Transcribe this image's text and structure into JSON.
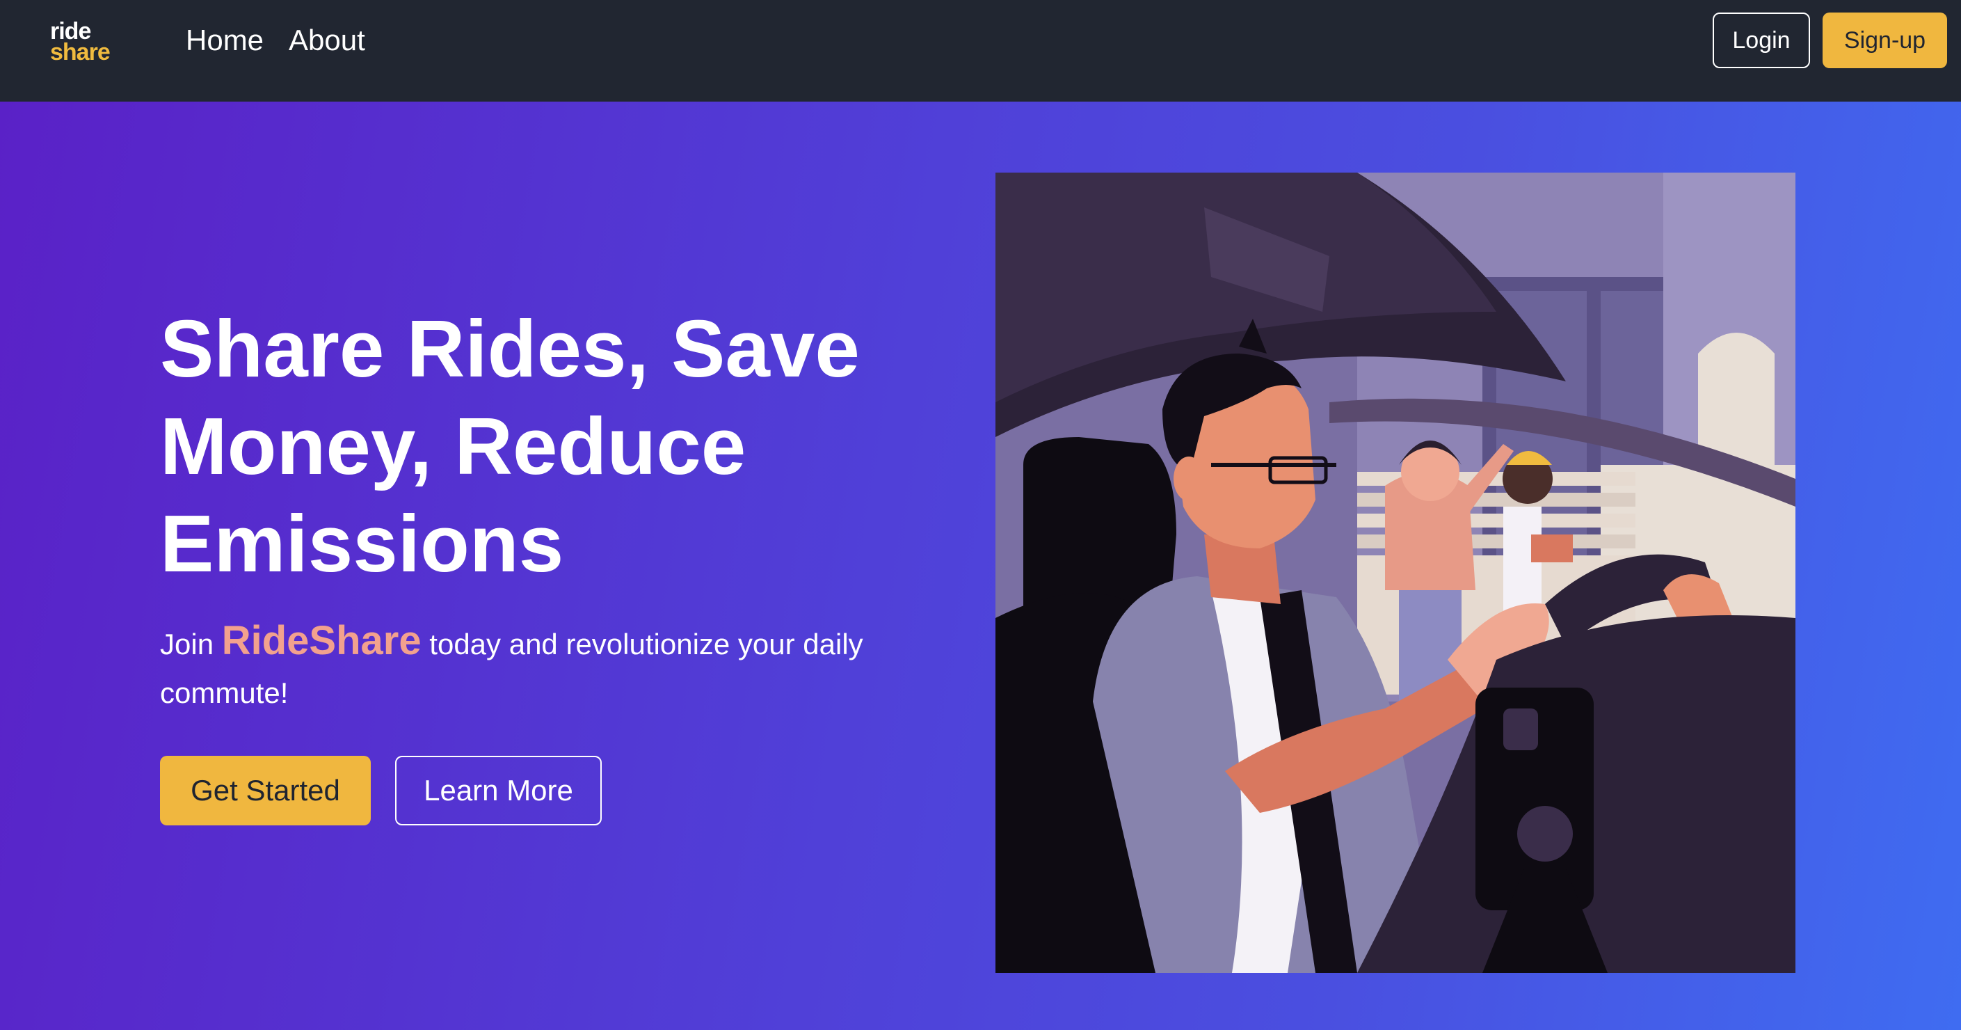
{
  "brand": {
    "logo_line1": "ride",
    "logo_line2": "share",
    "accent_color": "#f0b73f",
    "nav_bg_color": "#212631"
  },
  "nav": {
    "links": [
      {
        "label": "Home"
      },
      {
        "label": "About"
      }
    ],
    "login_label": "Login",
    "signup_label": "Sign-up"
  },
  "hero": {
    "headline": "Share Rides, Save Money, Reduce Emissions",
    "sub_prefix": "Join",
    "sub_brand": "RideShare",
    "sub_suffix": "today and revolutionize your daily commute!",
    "brand_highlight_color": "#f2a18e",
    "primary_cta": "Get Started",
    "secondary_cta": "Learn More",
    "gradient_colors": [
      "#5a21c7",
      "#3f6cf1"
    ],
    "illustration": "driver-with-waving-passengers-illustration"
  }
}
